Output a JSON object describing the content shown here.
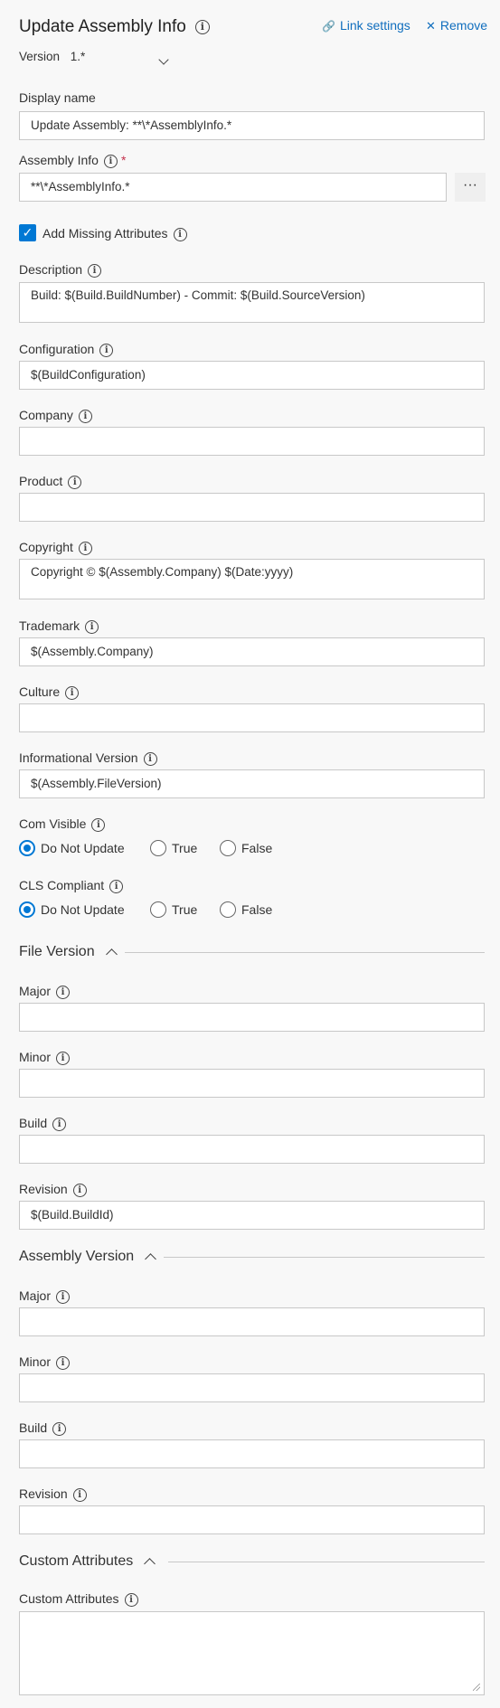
{
  "header": {
    "title": "Update Assembly Info",
    "link_settings": "Link settings",
    "remove": "Remove",
    "version_label": "Version",
    "version_value": "1.*"
  },
  "display_name": {
    "label": "Display name",
    "value": "Update Assembly: **\\*AssemblyInfo.*"
  },
  "assembly_info": {
    "label": "Assembly Info",
    "required": "*",
    "value": "**\\*AssemblyInfo.*",
    "browse": "···"
  },
  "add_missing": {
    "label": "Add Missing Attributes",
    "checked": true,
    "check_glyph": "✓"
  },
  "description": {
    "label": "Description",
    "value": "Build: $(Build.BuildNumber) - Commit: $(Build.SourceVersion)"
  },
  "configuration": {
    "label": "Configuration",
    "value": "$(BuildConfiguration)"
  },
  "company": {
    "label": "Company",
    "value": ""
  },
  "product": {
    "label": "Product",
    "value": ""
  },
  "copyright": {
    "label": "Copyright",
    "value": "Copyright © $(Assembly.Company) $(Date:yyyy)"
  },
  "trademark": {
    "label": "Trademark",
    "value": "$(Assembly.Company)"
  },
  "culture": {
    "label": "Culture",
    "value": ""
  },
  "informational_version": {
    "label": "Informational Version",
    "value": "$(Assembly.FileVersion)"
  },
  "com_visible": {
    "label": "Com Visible",
    "options": [
      "Do Not Update",
      "True",
      "False"
    ],
    "selected": "Do Not Update"
  },
  "cls_compliant": {
    "label": "CLS Compliant",
    "options": [
      "Do Not Update",
      "True",
      "False"
    ],
    "selected": "Do Not Update"
  },
  "file_version": {
    "title": "File Version",
    "major": {
      "label": "Major",
      "value": ""
    },
    "minor": {
      "label": "Minor",
      "value": ""
    },
    "build": {
      "label": "Build",
      "value": ""
    },
    "revision": {
      "label": "Revision",
      "value": "$(Build.BuildId)"
    }
  },
  "assembly_version": {
    "title": "Assembly Version",
    "major": {
      "label": "Major",
      "value": ""
    },
    "minor": {
      "label": "Minor",
      "value": ""
    },
    "build": {
      "label": "Build",
      "value": ""
    },
    "revision": {
      "label": "Revision",
      "value": ""
    }
  },
  "custom_attributes": {
    "title": "Custom Attributes",
    "label": "Custom Attributes",
    "value": ""
  },
  "icons": {
    "info": "i",
    "link": "🔗",
    "close": "✕"
  },
  "colors": {
    "accent": "#0078d4",
    "link": "#106ebe",
    "required": "#c4314b"
  }
}
